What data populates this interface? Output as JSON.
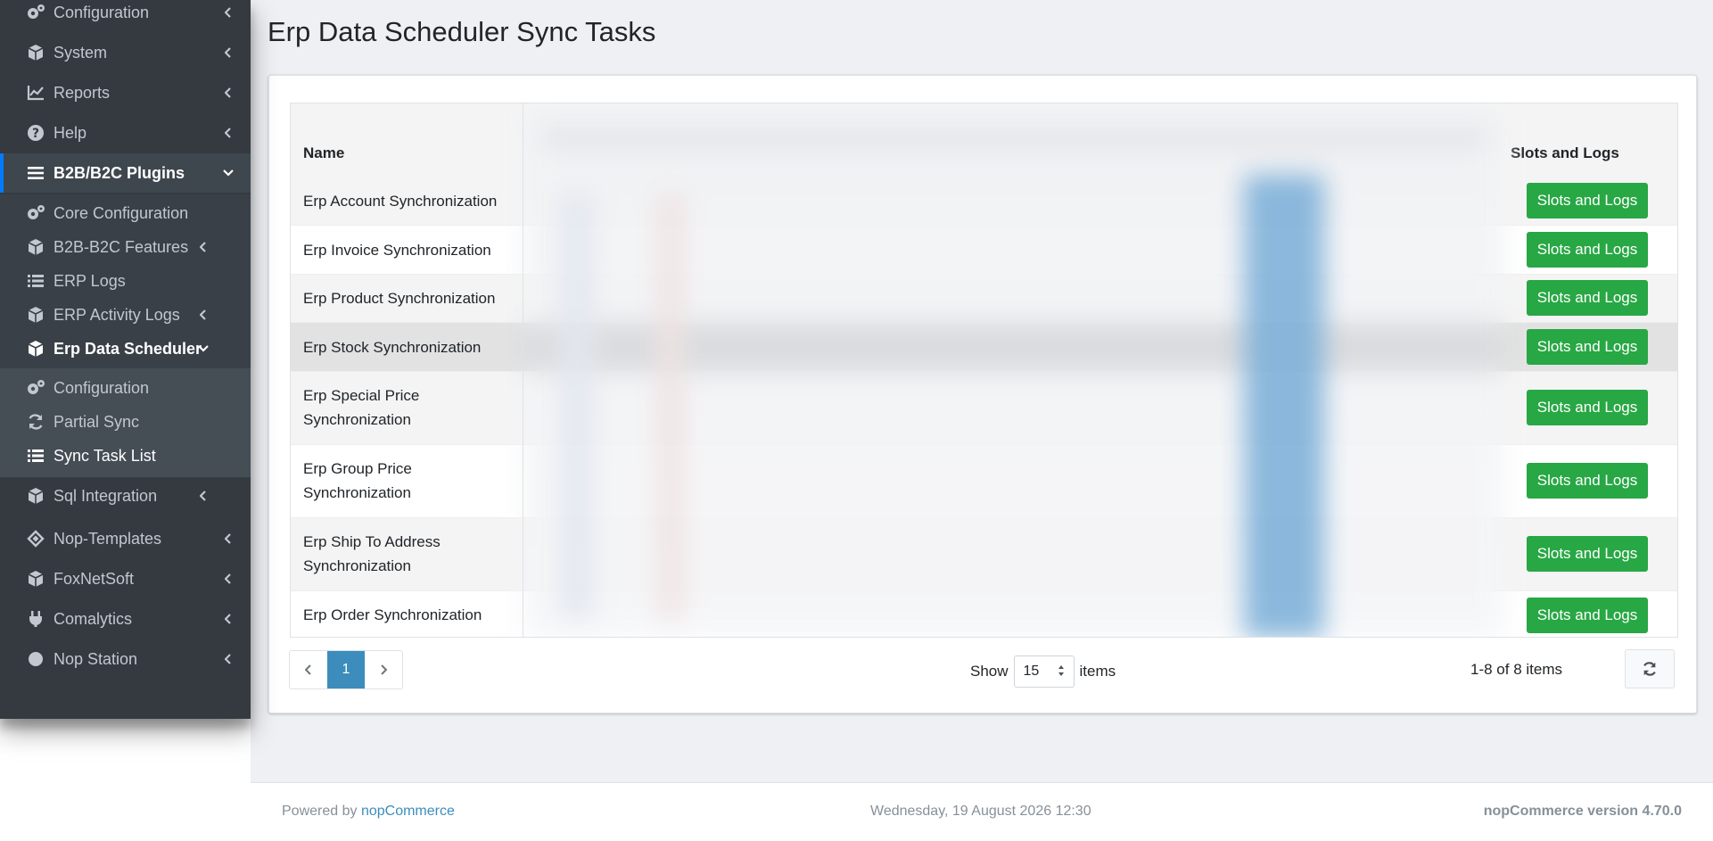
{
  "sidebar": {
    "items": [
      {
        "label": "Configuration",
        "icon": "gears-icon"
      },
      {
        "label": "System",
        "icon": "cube-icon"
      },
      {
        "label": "Reports",
        "icon": "chart-line-icon"
      },
      {
        "label": "Help",
        "icon": "question-circle-icon"
      },
      {
        "label": "B2B/B2C Plugins",
        "icon": "bars-icon"
      }
    ],
    "plugins_sub": [
      {
        "label": "Core Configuration",
        "icon": "gears-icon"
      },
      {
        "label": "B2B-B2C Features",
        "icon": "cube-icon"
      },
      {
        "label": "ERP Logs",
        "icon": "list-icon"
      },
      {
        "label": "ERP Activity Logs",
        "icon": "cube-icon"
      },
      {
        "label": "Erp Data Scheduler",
        "icon": "cube-icon"
      }
    ],
    "scheduler_sub": [
      {
        "label": "Configuration",
        "icon": "gears-icon"
      },
      {
        "label": "Partial Sync",
        "icon": "sync-icon"
      },
      {
        "label": "Sync Task List",
        "icon": "list-icon"
      }
    ],
    "after": [
      {
        "label": "Sql Integration",
        "icon": "cube-icon"
      },
      {
        "label": "Nop-Templates",
        "icon": "layers-icon"
      },
      {
        "label": "FoxNetSoft",
        "icon": "cube-icon"
      },
      {
        "label": "Comalytics",
        "icon": "plug-icon"
      },
      {
        "label": "Nop Station",
        "icon": "circle-icon"
      }
    ]
  },
  "page": {
    "title": "Erp Data Scheduler Sync Tasks"
  },
  "grid": {
    "columns": {
      "name": "Name",
      "slots": "Slots and Logs"
    },
    "rows": [
      {
        "name": "Erp Account Synchronization",
        "button": "Slots and Logs"
      },
      {
        "name": "Erp Invoice Synchronization",
        "button": "Slots and Logs"
      },
      {
        "name": "Erp Product Synchronization",
        "button": "Slots and Logs"
      },
      {
        "name": "Erp Stock Synchronization",
        "button": "Slots and Logs"
      },
      {
        "name": "Erp Special Price Synchronization",
        "button": "Slots and Logs"
      },
      {
        "name": "Erp Group Price Synchronization",
        "button": "Slots and Logs"
      },
      {
        "name": "Erp Ship To Address Synchronization",
        "button": "Slots and Logs"
      },
      {
        "name": "Erp Order Synchronization",
        "button": "Slots and Logs"
      }
    ]
  },
  "pager": {
    "current_page": "1",
    "show_label": "Show",
    "page_size": "15",
    "items_label": "items",
    "range_info": "1-8 of 8 items"
  },
  "footer": {
    "powered_by": "Powered by",
    "powered_link": "nopCommerce",
    "date": "Wednesday, 19 August 2026 12:30",
    "version": "nopCommerce version 4.70.0"
  },
  "colors": {
    "sidebar_bg": "#343a40",
    "accent": "#007bff",
    "button_green": "#28a745",
    "pager_active": "#3c8dbc"
  }
}
